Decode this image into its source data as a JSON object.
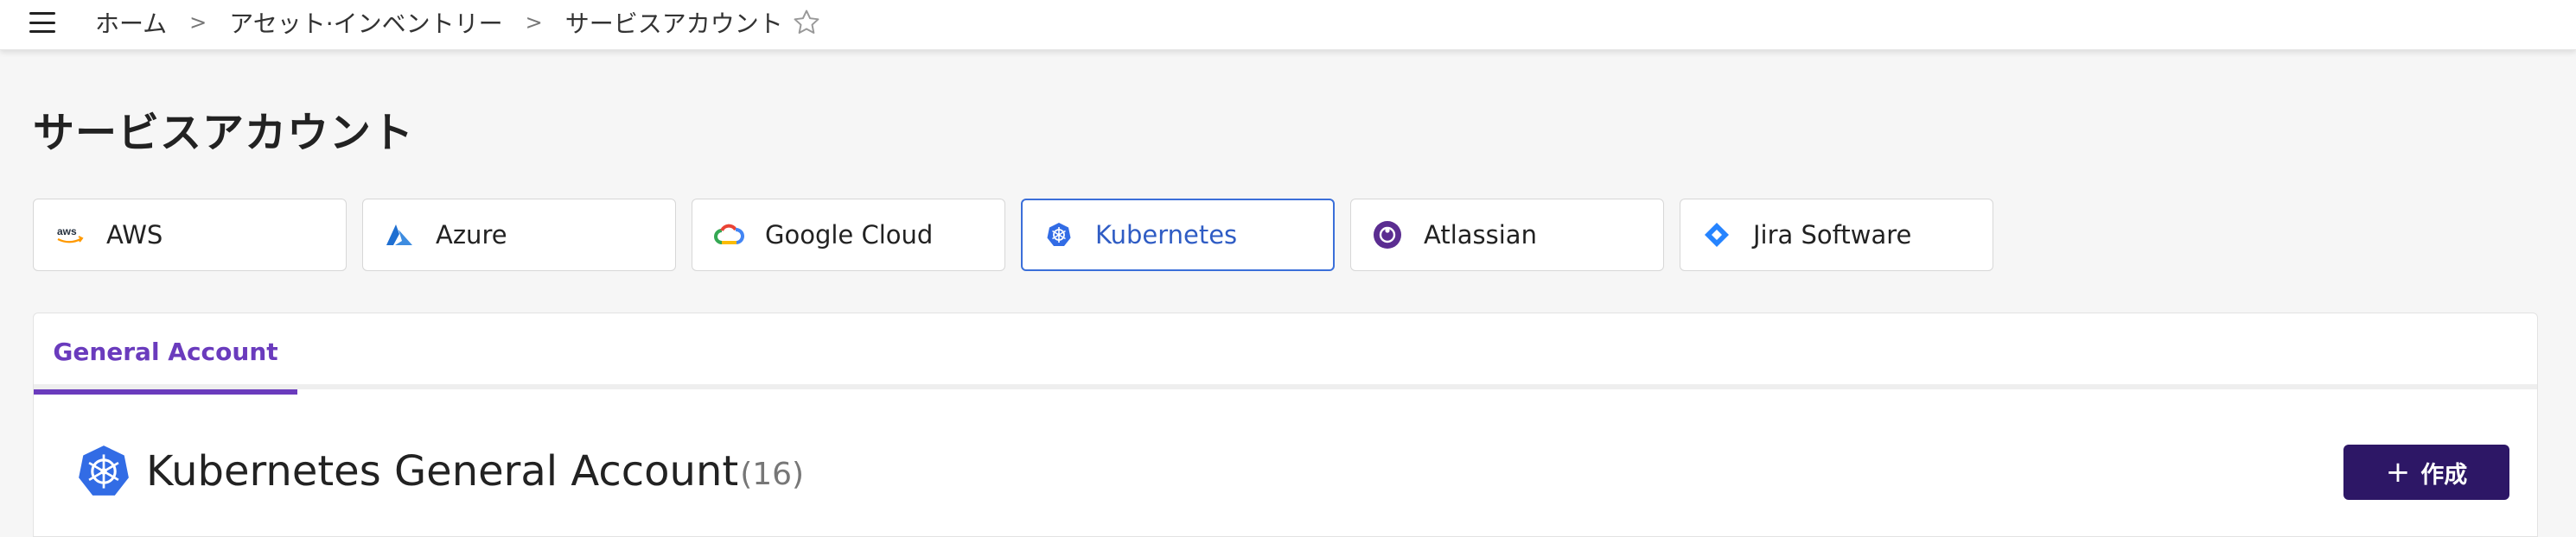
{
  "breadcrumb": {
    "home": "ホーム",
    "assets": "アセット·インベントリー",
    "current": "サービスアカウント"
  },
  "page": {
    "title": "サービスアカウント"
  },
  "providers": [
    {
      "label": "AWS",
      "icon": "aws-icon"
    },
    {
      "label": "Azure",
      "icon": "azure-icon"
    },
    {
      "label": "Google Cloud",
      "icon": "google-cloud-icon"
    },
    {
      "label": "Kubernetes",
      "icon": "kubernetes-icon",
      "selected": true
    },
    {
      "label": "Atlassian",
      "icon": "atlassian-icon"
    },
    {
      "label": "Jira Software",
      "icon": "jira-icon"
    }
  ],
  "tabs": [
    {
      "label": "General Account",
      "active": true
    }
  ],
  "section": {
    "title": "Kubernetes General Account",
    "count": "(16)"
  },
  "actions": {
    "create_label": "作成"
  },
  "colors": {
    "accent": "#6a3bbd",
    "selected_border": "#3b6fd9",
    "button_bg": "#2d1766",
    "kubernetes": "#326ce5"
  }
}
